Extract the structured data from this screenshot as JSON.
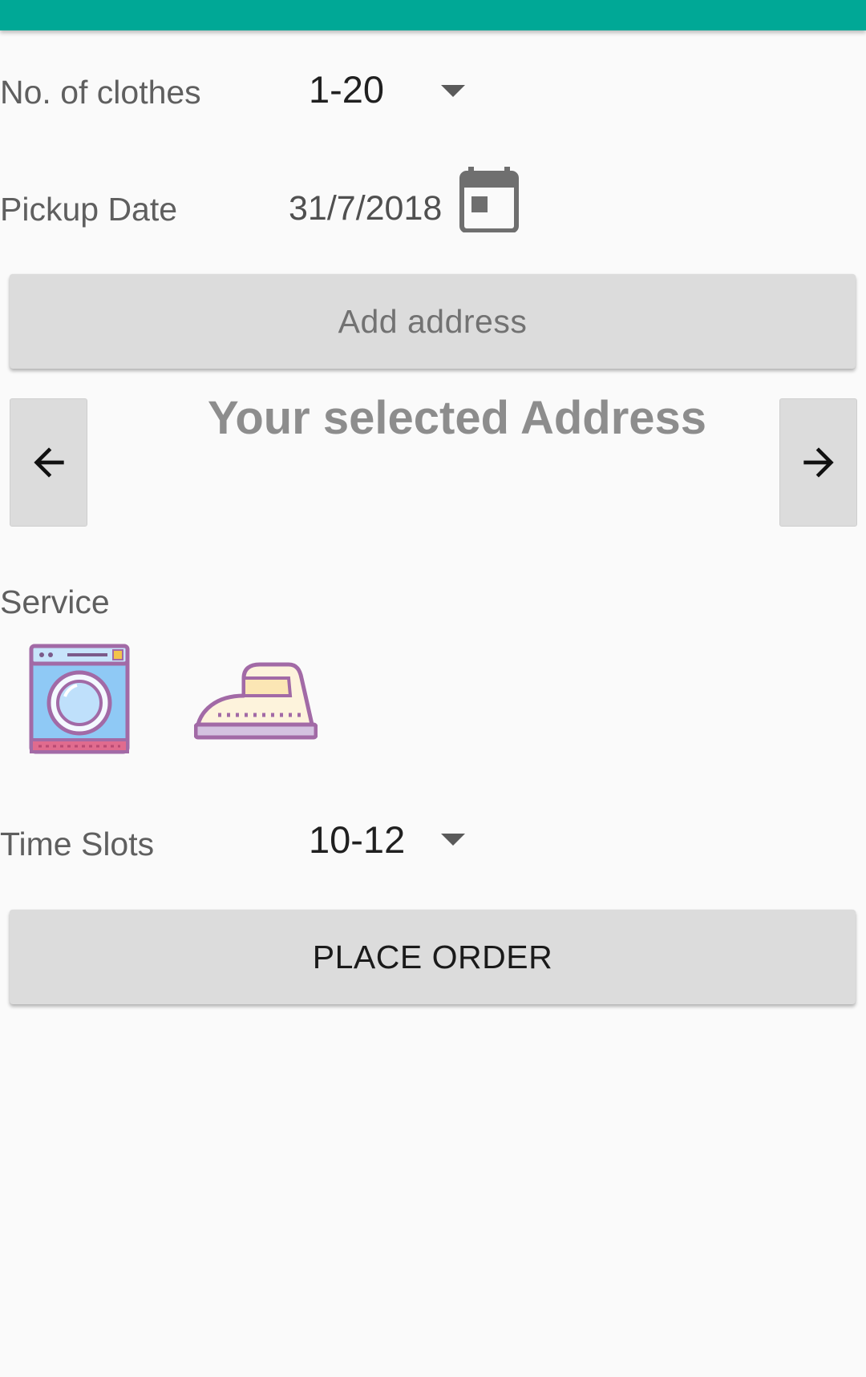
{
  "form": {
    "clothes": {
      "label": "No. of clothes",
      "selected": "1-20"
    },
    "pickup": {
      "label": "Pickup Date",
      "value": "31/7/2018"
    },
    "add_address_label": "Add address",
    "address": {
      "heading": "Your selected Address"
    },
    "service": {
      "label": "Service",
      "options": [
        "washing-machine-icon",
        "iron-icon"
      ]
    },
    "time_slots": {
      "label": "Time Slots",
      "selected": "10-12"
    },
    "place_order_label": "PLACE ORDER"
  },
  "colors": {
    "app_bar": "#00a896",
    "button_bg": "#dcdcdc",
    "background": "#fafafa"
  }
}
